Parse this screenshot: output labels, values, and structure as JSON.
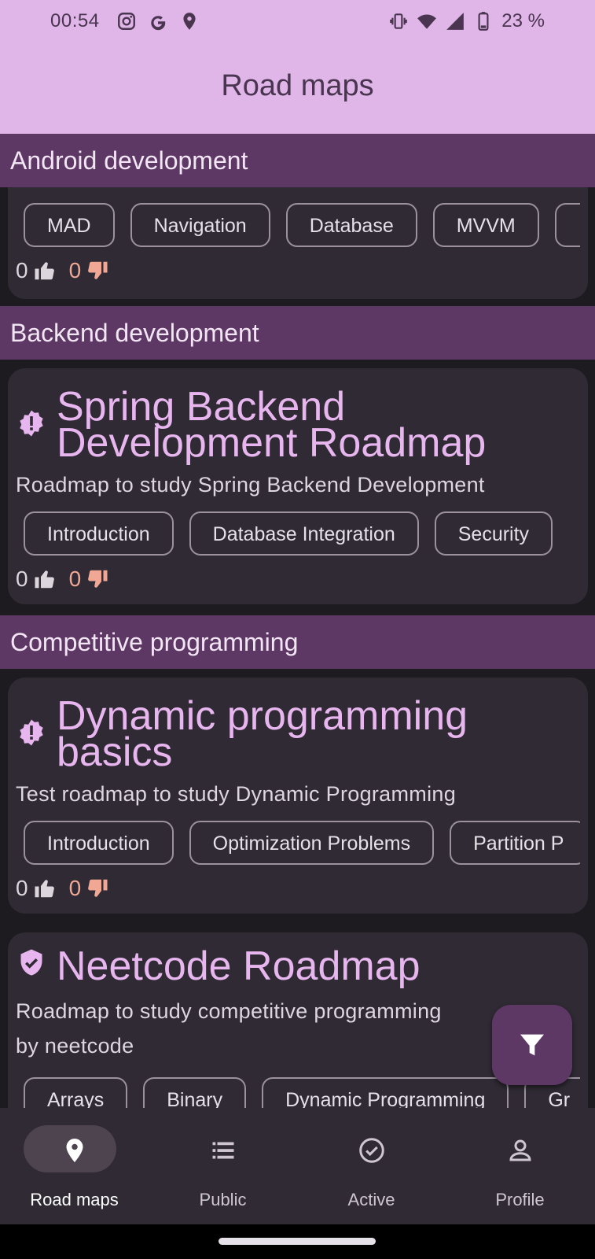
{
  "status_bar": {
    "time": "00:54",
    "battery": "23 %",
    "left_icons": [
      "instagram-icon",
      "google-icon",
      "location-icon"
    ],
    "right_icons": [
      "vibrate-icon",
      "wifi-icon",
      "signal-icon",
      "battery-icon"
    ]
  },
  "app_bar": {
    "title": "Road maps"
  },
  "sections": [
    {
      "header": "Android development",
      "cards": [
        {
          "chips": [
            "MAD",
            "Navigation",
            "Database",
            "MVVM"
          ],
          "likes": "0",
          "dislikes": "0"
        }
      ]
    },
    {
      "header": "Backend development",
      "cards": [
        {
          "badge": "unverified-badge-icon",
          "title_line1": "Spring Backend",
          "title_line2": "Development Roadmap",
          "description": "Roadmap to study Spring Backend Development",
          "chips": [
            "Introduction",
            "Database Integration",
            "Security"
          ],
          "likes": "0",
          "dislikes": "0"
        }
      ]
    },
    {
      "header": "Competitive programming",
      "cards": [
        {
          "badge": "unverified-badge-icon",
          "title_line1": "Dynamic programming",
          "title_line2": "basics",
          "description": "Test roadmap to study Dynamic Programming",
          "chips": [
            "Introduction",
            "Optimization Problems",
            "Partition P"
          ],
          "likes": "0",
          "dislikes": "0"
        },
        {
          "badge": "verified-shield-icon",
          "title_line1": "Neetcode Roadmap",
          "description_line1": "Roadmap to study competitive programming",
          "description_line2": "by neetcode",
          "chips": [
            "Arrays",
            "Binary",
            "Dynamic Programming",
            "Gr"
          ]
        }
      ]
    }
  ],
  "fab": {
    "icon": "filter-icon"
  },
  "bottom_nav": [
    {
      "label": "Road maps",
      "icon": "map-pin-icon",
      "active": true
    },
    {
      "label": "Public",
      "icon": "list-icon",
      "active": false
    },
    {
      "label": "Active",
      "icon": "check-circle-icon",
      "active": false
    },
    {
      "label": "Profile",
      "icon": "person-icon",
      "active": false
    }
  ],
  "colors": {
    "top_bar": "#e0b6e8",
    "section_header": "#5e3865",
    "card": "#2f2a33",
    "title": "#e8b6ef",
    "dislike": "#f0a894"
  }
}
